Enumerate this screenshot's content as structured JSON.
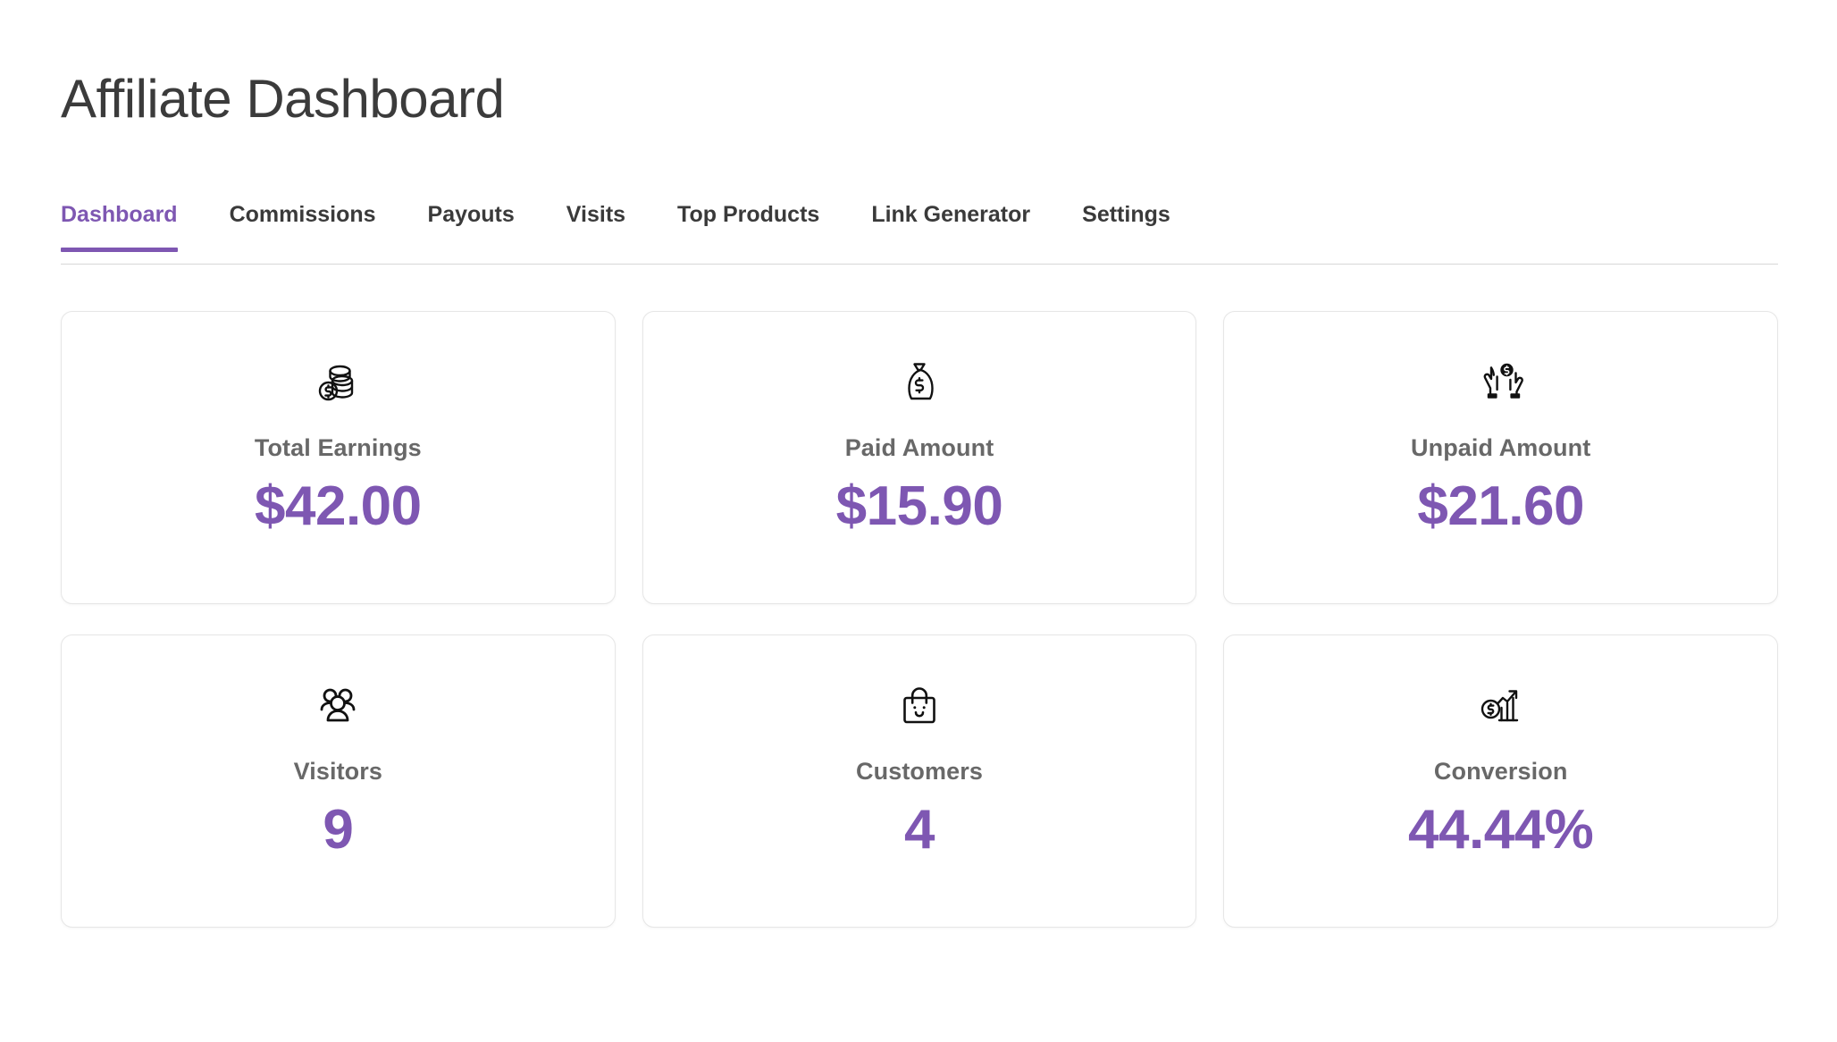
{
  "header": {
    "title": "Affiliate Dashboard"
  },
  "tabs": [
    {
      "label": "Dashboard",
      "name": "tab-dashboard",
      "active": true
    },
    {
      "label": "Commissions",
      "name": "tab-commissions",
      "active": false
    },
    {
      "label": "Payouts",
      "name": "tab-payouts",
      "active": false
    },
    {
      "label": "Visits",
      "name": "tab-visits",
      "active": false
    },
    {
      "label": "Top Products",
      "name": "tab-top-products",
      "active": false
    },
    {
      "label": "Link Generator",
      "name": "tab-link-generator",
      "active": false
    },
    {
      "label": "Settings",
      "name": "tab-settings",
      "active": false
    }
  ],
  "stats": [
    {
      "title": "Total Earnings",
      "value": "$42.00",
      "icon": "coins-stack-icon",
      "card_name": "stat-card-total-earnings"
    },
    {
      "title": "Paid Amount",
      "value": "$15.90",
      "icon": "money-bag-icon",
      "card_name": "stat-card-paid-amount"
    },
    {
      "title": "Unpaid Amount",
      "value": "$21.60",
      "icon": "hands-holding-coin-icon",
      "card_name": "stat-card-unpaid-amount"
    },
    {
      "title": "Visitors",
      "value": "9",
      "icon": "users-group-icon",
      "card_name": "stat-card-visitors"
    },
    {
      "title": "Customers",
      "value": "4",
      "icon": "shopping-bag-smile-icon",
      "card_name": "stat-card-customers"
    },
    {
      "title": "Conversion",
      "value": "44.44%",
      "icon": "growth-chart-dollar-icon",
      "card_name": "stat-card-conversion"
    }
  ],
  "colors": {
    "accent": "#7e57b2",
    "label": "#686868",
    "tab_inactive": "#3a3a3a",
    "divider": "#d7d7d7",
    "card_border": "#e6e6e6"
  }
}
